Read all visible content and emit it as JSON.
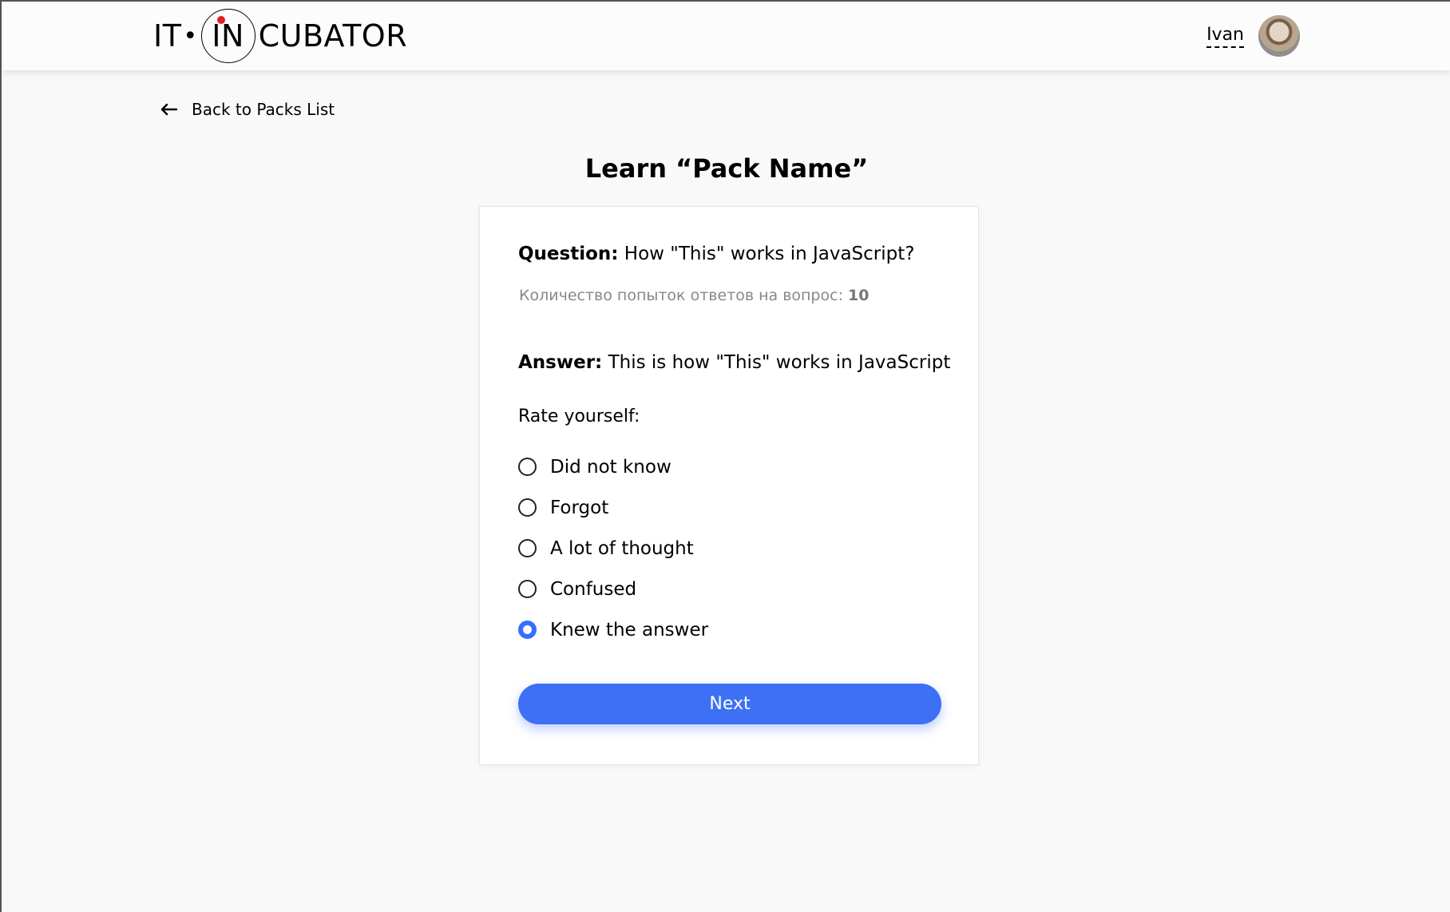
{
  "header": {
    "logo_left": "IT",
    "logo_dot": "•",
    "logo_middle": "IN",
    "logo_right": "CUBATOR",
    "user_name": "Ivan"
  },
  "back_link": "Back to Packs List",
  "page_title": "Learn “Pack Name”",
  "card": {
    "question_label": "Question:",
    "question_text": " How \"This\" works in JavaScript?",
    "attempts_label": "Количество попыток ответов на вопрос: ",
    "attempts_value": "10",
    "answer_label": "Answer:",
    "answer_text": " This is how \"This\" works in JavaScript",
    "rate_label": "Rate yourself:",
    "options": [
      {
        "label": "Did not know",
        "checked": false
      },
      {
        "label": "Forgot",
        "checked": false
      },
      {
        "label": "A lot of thought",
        "checked": false
      },
      {
        "label": "Confused",
        "checked": false
      },
      {
        "label": "Knew the answer",
        "checked": true
      }
    ],
    "next_label": "Next"
  },
  "colors": {
    "accent": "#366eff",
    "logo_dot_red": "#e02020"
  }
}
